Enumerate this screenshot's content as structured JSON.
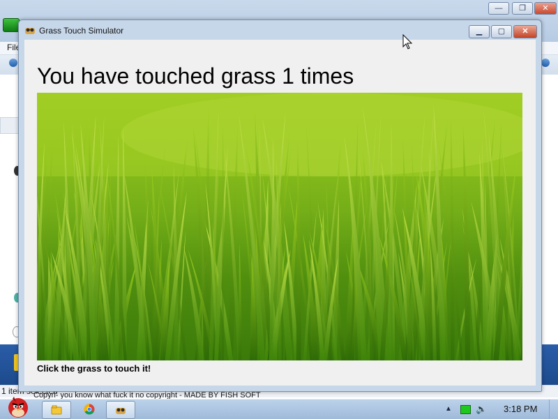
{
  "app": {
    "title": "Grass Touch Simulator",
    "heading": "You have touched grass 1 times",
    "instruction": "Click the grass to touch it!",
    "copyright": "Copyri- you know what fuck it no copyright - MADE BY FISH SOFT"
  },
  "background_window": {
    "menu_file": "File",
    "status_text": "1 item selected"
  },
  "taskbar": {
    "clock": "3:18 PM",
    "tasks": [
      "explorer-icon",
      "chrome-icon",
      "grass-app-icon"
    ]
  },
  "colors": {
    "grass_light": "#9fcc22",
    "grass_dark": "#3b7a0a",
    "close_red": "#c44225"
  }
}
